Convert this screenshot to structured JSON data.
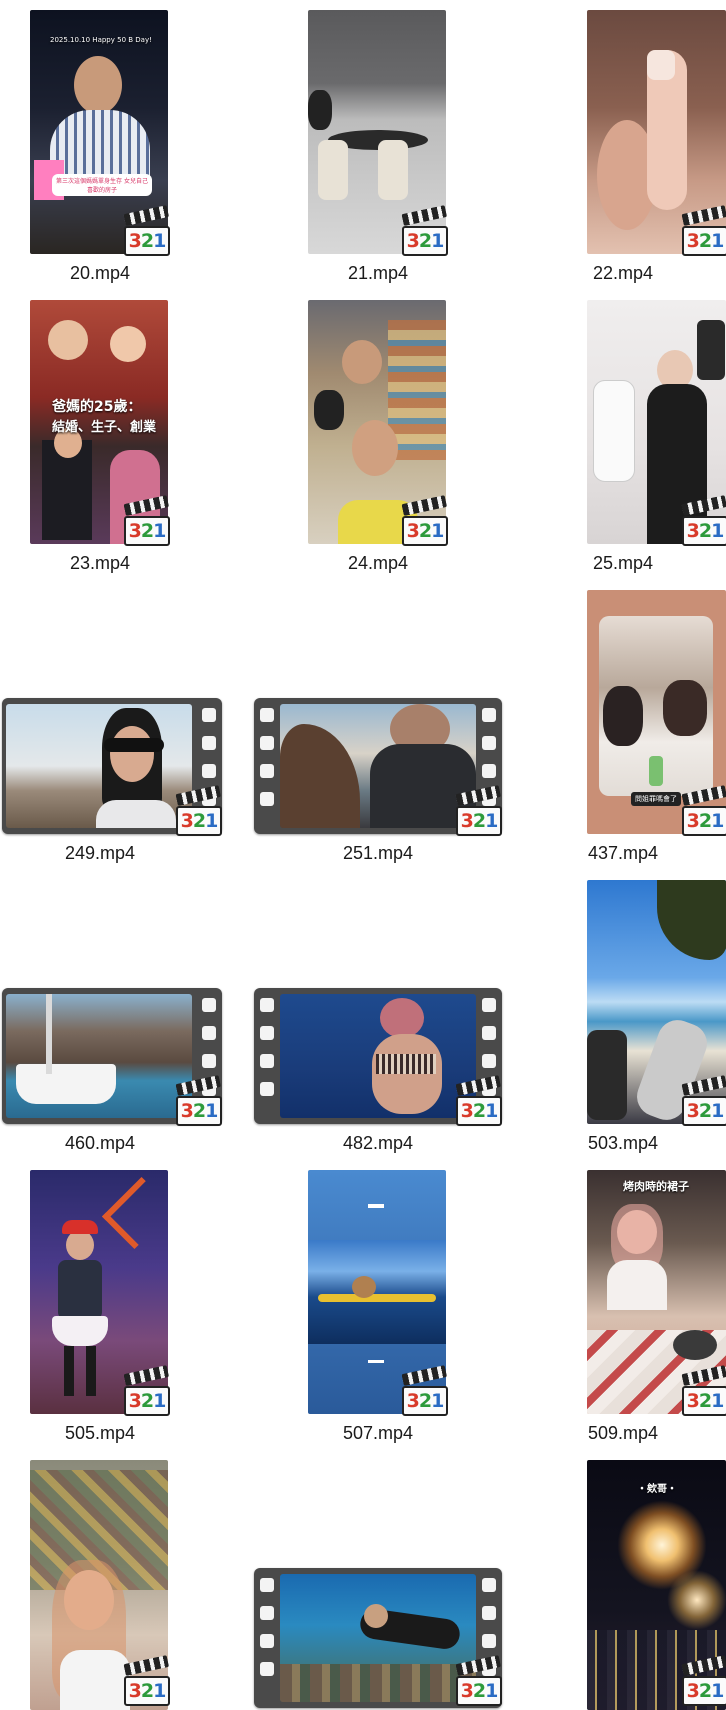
{
  "files": [
    {
      "name": "20.mp4"
    },
    {
      "name": "21.mp4"
    },
    {
      "name": "22.mp4"
    },
    {
      "name": "23.mp4"
    },
    {
      "name": "24.mp4"
    },
    {
      "name": "25.mp4"
    },
    {
      "name": "249.mp4"
    },
    {
      "name": "251.mp4"
    },
    {
      "name": "437.mp4"
    },
    {
      "name": "460.mp4"
    },
    {
      "name": "482.mp4"
    },
    {
      "name": "503.mp4"
    },
    {
      "name": "505.mp4"
    },
    {
      "name": "507.mp4"
    },
    {
      "name": "509.mp4"
    }
  ],
  "overlays": {
    "t20_caption": "2025.10.10 Happy 50 B Day!",
    "t20_sticker": "第三次這個媽媽單身生存 女兒自己喜歡的房子",
    "t23_title": "爸媽的25歲：",
    "t23_sub": "結婚、生子、創業",
    "t437_sticker": "問姐罪嗎會了",
    "t509_title": "烤肉時的裙子",
    "t_fireworks": "・欸哥・"
  },
  "badge": {
    "digit3": "3",
    "digit2": "2",
    "digit1": "1"
  }
}
